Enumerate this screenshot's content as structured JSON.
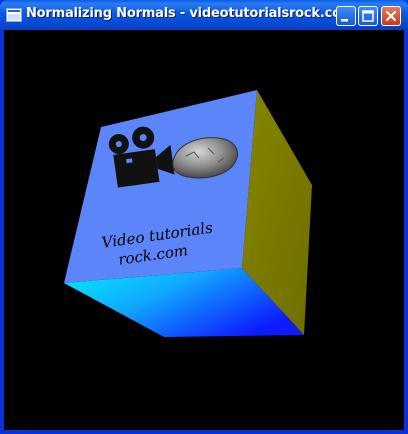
{
  "window": {
    "title": "Normalizing Normals - videotutorialsrock.com"
  },
  "cube": {
    "front_text_line1": "Video tutorials",
    "front_text_line2": "rock.com",
    "colors": {
      "front": "#5b85f8",
      "right": "#7a7a00",
      "bottom": "#1030ff",
      "bottom_highlight": "#00e8ff",
      "background": "#000000"
    },
    "icons": [
      "film-camera-icon",
      "rock-icon"
    ]
  }
}
